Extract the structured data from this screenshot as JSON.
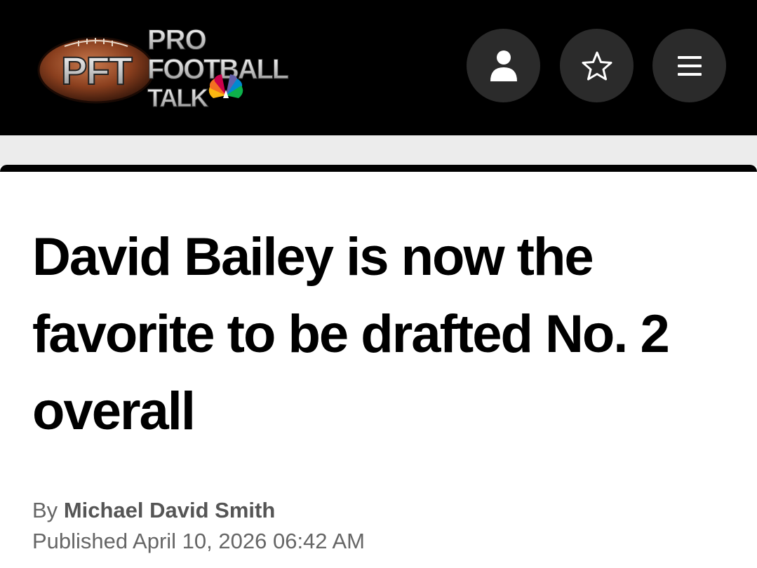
{
  "header": {
    "logo": {
      "abbreviation": "PFT",
      "line1": "PRO",
      "line2": "FOOTBALL",
      "line3": "TALK"
    },
    "buttons": [
      {
        "name": "account",
        "icon": "user-icon"
      },
      {
        "name": "favorites",
        "icon": "star-icon"
      },
      {
        "name": "menu",
        "icon": "hamburger-menu-icon"
      }
    ],
    "button_color": "#2b2b2b",
    "background_color": "#000000"
  },
  "article": {
    "headline": "David Bailey is now the favorite to be drafted No. 2 overall",
    "byline_prefix": "By",
    "author": "Michael David Smith",
    "published": "Published April 10, 2026 06:42 AM"
  }
}
